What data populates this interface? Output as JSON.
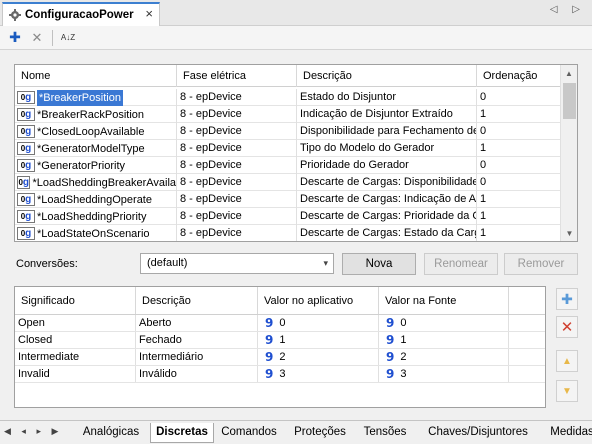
{
  "window": {
    "tab_title": "ConfiguracaoPower",
    "close_glyph": "×",
    "nav_glyphs": "◁ ▷",
    "tab_icon": "gear-icon"
  },
  "toolbar": {
    "add_label": "✚",
    "delete_label": "✕",
    "sort_label": "A↓Z",
    "colors": {
      "add": "#1a5bbf",
      "delete": "#8a8a8a"
    }
  },
  "grid": {
    "headers": [
      "Nome",
      "Fase elétrica",
      "Descrição",
      "Ordenação"
    ],
    "rows": [
      {
        "name": "*BreakerPosition",
        "fase": "8 - epDevice",
        "desc": "Estado do Disjuntor",
        "ord": "0"
      },
      {
        "name": "*BreakerRackPosition",
        "fase": "8 - epDevice",
        "desc": "Indicação de Disjuntor Extraído",
        "ord": "1"
      },
      {
        "name": "*ClosedLoopAvailable",
        "fase": "8 - epDevice",
        "desc": "Disponibilidade para Fechamento de",
        "ord": "0"
      },
      {
        "name": "*GeneratorModelType",
        "fase": "8 - epDevice",
        "desc": "Tipo do Modelo do Gerador",
        "ord": "1"
      },
      {
        "name": "*GeneratorPriority",
        "fase": "8 - epDevice",
        "desc": "Prioridade do Gerador",
        "ord": "0"
      },
      {
        "name": "*LoadSheddingBreakerAvaila",
        "fase": "8 - epDevice",
        "desc": "Descarte de Cargas: Disponibilidade",
        "ord": "0"
      },
      {
        "name": "*LoadSheddingOperate",
        "fase": "8 - epDevice",
        "desc": "Descarte de Cargas: Indicação de Ab",
        "ord": "1"
      },
      {
        "name": "*LoadSheddingPriority",
        "fase": "8 - epDevice",
        "desc": "Descarte de Cargas: Prioridade da C",
        "ord": "1"
      },
      {
        "name": "*LoadStateOnScenario",
        "fase": "8 - epDevice",
        "desc": "Descarte de Cargas: Estado da Carg",
        "ord": "1"
      }
    ],
    "row_icon_text": "0",
    "row_icon_glyph": "g",
    "selected_index": 0,
    "scroll_up": "▲",
    "scroll_down": "▼",
    "selection_color": "#3a78d4"
  },
  "conversions": {
    "label": "Conversões:",
    "selected": "(default)",
    "chevron": "▾",
    "new_button": "Nova",
    "rename_button": "Renomear",
    "remove_button": "Remover"
  },
  "meanings": {
    "headers": [
      "Significado",
      "Descrição",
      "Valor no aplicativo",
      "Valor na Fonte"
    ],
    "rows": [
      {
        "sig": "Open",
        "desc": "Aberto",
        "app": "0",
        "src": "0"
      },
      {
        "sig": "Closed",
        "desc": "Fechado",
        "app": "1",
        "src": "1"
      },
      {
        "sig": "Intermediate",
        "desc": "Intermediário",
        "app": "2",
        "src": "2"
      },
      {
        "sig": "Invalid",
        "desc": "Inválido",
        "app": "3",
        "src": "3"
      }
    ],
    "value_glyph": "9"
  },
  "side_buttons": {
    "add": "✚",
    "remove": "✕",
    "up": "▲",
    "down": "▼",
    "colors": {
      "add": "#5a9ad8",
      "remove": "#d04030",
      "arrows": "#e8b84a"
    }
  },
  "bottom_tabs": {
    "nav": "◀ ◂ ▸ ▶",
    "tabs": [
      "Analógicas",
      "Discretas",
      "Comandos",
      "Proteções",
      "Tensões",
      "Chaves/Disjuntores",
      "Medidas"
    ],
    "active_index": 1
  }
}
